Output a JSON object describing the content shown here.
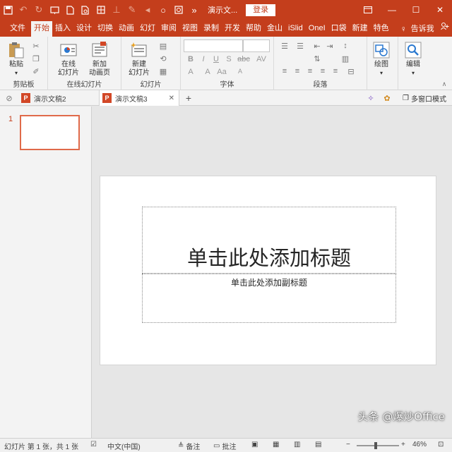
{
  "app": {
    "doc_title": "演示文...",
    "login_label": "登录"
  },
  "tabs": [
    {
      "label": "文件"
    },
    {
      "label": "开始"
    },
    {
      "label": "插入"
    },
    {
      "label": "设计"
    },
    {
      "label": "切换"
    },
    {
      "label": "动画"
    },
    {
      "label": "幻灯"
    },
    {
      "label": "审阅"
    },
    {
      "label": "视图"
    },
    {
      "label": "录制"
    },
    {
      "label": "开发"
    },
    {
      "label": "帮助"
    },
    {
      "label": "金山"
    },
    {
      "label": "iSlid"
    },
    {
      "label": "OneI"
    },
    {
      "label": "口袋"
    },
    {
      "label": "新建"
    },
    {
      "label": "特色"
    }
  ],
  "tell_me": "告诉我",
  "active_tab": "开始",
  "ribbon": {
    "clipboard": {
      "paste_label": "粘贴",
      "group_label": "剪贴板"
    },
    "online_slides": {
      "btn1_line1": "在线",
      "btn1_line2": "幻灯片",
      "btn2_line1": "新加",
      "btn2_line2": "动画页",
      "group_label": "在线幻灯片"
    },
    "slides": {
      "new_line1": "新建",
      "new_line2": "幻灯片",
      "group_label": "幻灯片"
    },
    "font": {
      "group_label": "字体",
      "bold": "B",
      "italic": "I",
      "underline": "U",
      "strike": "S",
      "abc": "abc",
      "av": "AV",
      "font_color": "A",
      "aa": "Aa",
      "grow": "A",
      "shrink": "A"
    },
    "paragraph": {
      "group_label": "段落"
    },
    "drawing": {
      "label": "绘图"
    },
    "editing": {
      "label": "编辑"
    }
  },
  "doc_tabs": [
    {
      "label": "演示文稿2",
      "active": false
    },
    {
      "label": "演示文稿3",
      "active": true
    }
  ],
  "multi_window_label": "多窗口模式",
  "thumbnails": [
    {
      "number": "1"
    }
  ],
  "slide": {
    "title_placeholder": "单击此处添加标题",
    "subtitle_placeholder": "单击此处添加副标题"
  },
  "status": {
    "slide_info": "幻灯片 第 1 张，共 1 张",
    "language": "中文(中国)",
    "notes": "备注",
    "comments": "批注",
    "zoom": "46%"
  },
  "watermark": "头条 @爆炒Office",
  "colors": {
    "accent": "#c43e1c"
  }
}
